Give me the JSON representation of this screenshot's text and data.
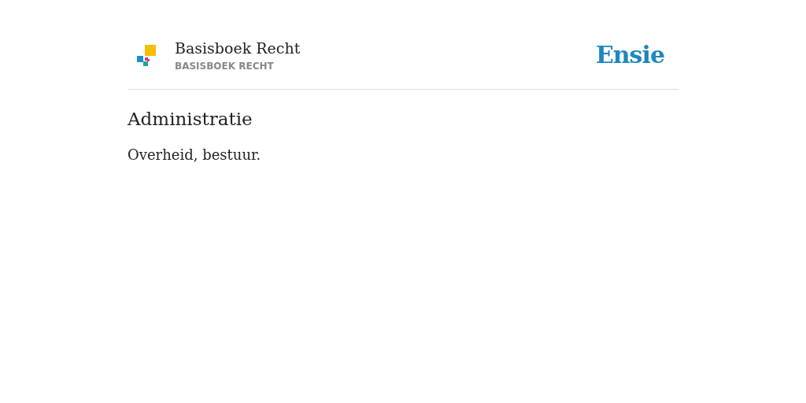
{
  "header": {
    "book_title": "Basisboek Recht",
    "book_subtitle": "BASISBOEK RECHT",
    "brand": "Ensie"
  },
  "entry": {
    "term": "Administratie",
    "definition": "Overheid, bestuur."
  }
}
